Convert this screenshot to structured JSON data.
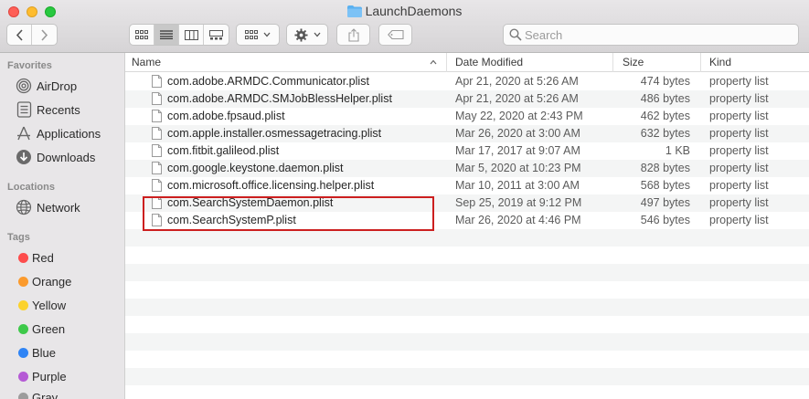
{
  "window": {
    "title": "LaunchDaemons"
  },
  "search": {
    "placeholder": "Search"
  },
  "sidebar": {
    "favorites_label": "Favorites",
    "favorites": [
      {
        "label": "AirDrop",
        "icon": "airdrop-icon"
      },
      {
        "label": "Recents",
        "icon": "clock-icon"
      },
      {
        "label": "Applications",
        "icon": "applications-icon"
      },
      {
        "label": "Downloads",
        "icon": "download-icon"
      }
    ],
    "locations_label": "Locations",
    "locations": [
      {
        "label": "Network",
        "icon": "network-icon"
      }
    ],
    "tags_label": "Tags",
    "tags": [
      {
        "label": "Red",
        "color": "#fd4c4c"
      },
      {
        "label": "Orange",
        "color": "#fb9a2d"
      },
      {
        "label": "Yellow",
        "color": "#fbd22d"
      },
      {
        "label": "Green",
        "color": "#3ec94a"
      },
      {
        "label": "Blue",
        "color": "#2f84f5"
      },
      {
        "label": "Purple",
        "color": "#b55ad5"
      },
      {
        "label": "Gray",
        "color": "#9c9c9c"
      }
    ]
  },
  "columns": {
    "name": "Name",
    "date": "Date Modified",
    "size": "Size",
    "kind": "Kind"
  },
  "files": [
    {
      "name": "com.adobe.ARMDC.Communicator.plist",
      "date": "Apr 21, 2020 at 5:26 AM",
      "size": "474 bytes",
      "kind": "property list"
    },
    {
      "name": "com.adobe.ARMDC.SMJobBlessHelper.plist",
      "date": "Apr 21, 2020 at 5:26 AM",
      "size": "486 bytes",
      "kind": "property list"
    },
    {
      "name": "com.adobe.fpsaud.plist",
      "date": "May 22, 2020 at 2:43 PM",
      "size": "462 bytes",
      "kind": "property list"
    },
    {
      "name": "com.apple.installer.osmessagetracing.plist",
      "date": "Mar 26, 2020 at 3:00 AM",
      "size": "632 bytes",
      "kind": "property list"
    },
    {
      "name": "com.fitbit.galileod.plist",
      "date": "Mar 17, 2017 at 9:07 AM",
      "size": "1 KB",
      "kind": "property list"
    },
    {
      "name": "com.google.keystone.daemon.plist",
      "date": "Mar 5, 2020 at 10:23 PM",
      "size": "828 bytes",
      "kind": "property list"
    },
    {
      "name": "com.microsoft.office.licensing.helper.plist",
      "date": "Mar 10, 2011 at 3:00 AM",
      "size": "568 bytes",
      "kind": "property list"
    },
    {
      "name": "com.SearchSystemDaemon.plist",
      "date": "Sep 25, 2019 at 9:12 PM",
      "size": "497 bytes",
      "kind": "property list"
    },
    {
      "name": "com.SearchSystemP.plist",
      "date": "Mar 26, 2020 at 4:46 PM",
      "size": "546 bytes",
      "kind": "property list"
    }
  ],
  "colors": {
    "highlight": "#cc1f1f",
    "folder": "#5ab0f0"
  }
}
